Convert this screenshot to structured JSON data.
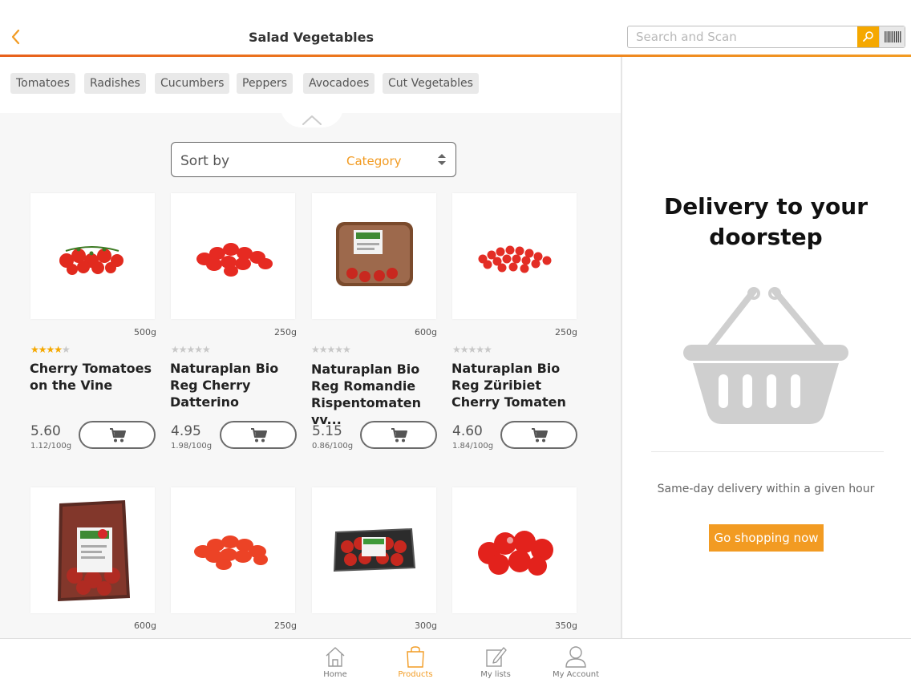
{
  "header": {
    "title": "Salad Vegetables",
    "search_placeholder": "Search and Scan",
    "accent_color": "#f29b22"
  },
  "categories": [
    {
      "label": "Tomatoes"
    },
    {
      "label": "Radishes"
    },
    {
      "label": "Cucumbers"
    },
    {
      "label": "Peppers"
    },
    {
      "label": "Avocadoes"
    },
    {
      "label": "Cut Vegetables"
    }
  ],
  "sort": {
    "label": "Sort by",
    "value": "Category"
  },
  "products": [
    {
      "name": "Cherry Tomatoes on the Vine",
      "weight": "500g",
      "price": "5.60",
      "unit_price": "1.12/100g",
      "rating": 4,
      "image": "cherry-tomato-vine"
    },
    {
      "name": "Naturaplan Bio Reg Cherry Datterino",
      "weight": "250g",
      "price": "4.95",
      "unit_price": "1.98/100g",
      "rating": 0,
      "image": "datterino-tomatoes"
    },
    {
      "name": "Naturaplan Bio Reg Romandie Rispentomaten vv...",
      "weight": "600g",
      "price": "5.15",
      "unit_price": "0.86/100g",
      "rating": 0,
      "image": "packaged-tomatoes-tray"
    },
    {
      "name": "Naturaplan Bio Reg Züribiet Cherry Tomaten",
      "weight": "250g",
      "price": "4.60",
      "unit_price": "1.84/100g",
      "rating": 0,
      "image": "small-cherry-tomatoes"
    }
  ],
  "products_row2": [
    {
      "weight": "600g",
      "image": "bagged-tomatoes"
    },
    {
      "weight": "250g",
      "image": "plum-cherry-tomatoes"
    },
    {
      "weight": "300g",
      "image": "tomato-punnet"
    },
    {
      "weight": "350g",
      "image": "round-tomatoes"
    }
  ],
  "promo": {
    "title": "Delivery to your doorstep",
    "text": "Same-day delivery within a given hour",
    "button": "Go shopping now"
  },
  "tabs": [
    {
      "label": "Home",
      "icon": "home-icon",
      "active": false
    },
    {
      "label": "Products",
      "icon": "bag-icon",
      "active": true
    },
    {
      "label": "My lists",
      "icon": "edit-list-icon",
      "active": false
    },
    {
      "label": "My Account",
      "icon": "user-icon",
      "active": false
    }
  ]
}
